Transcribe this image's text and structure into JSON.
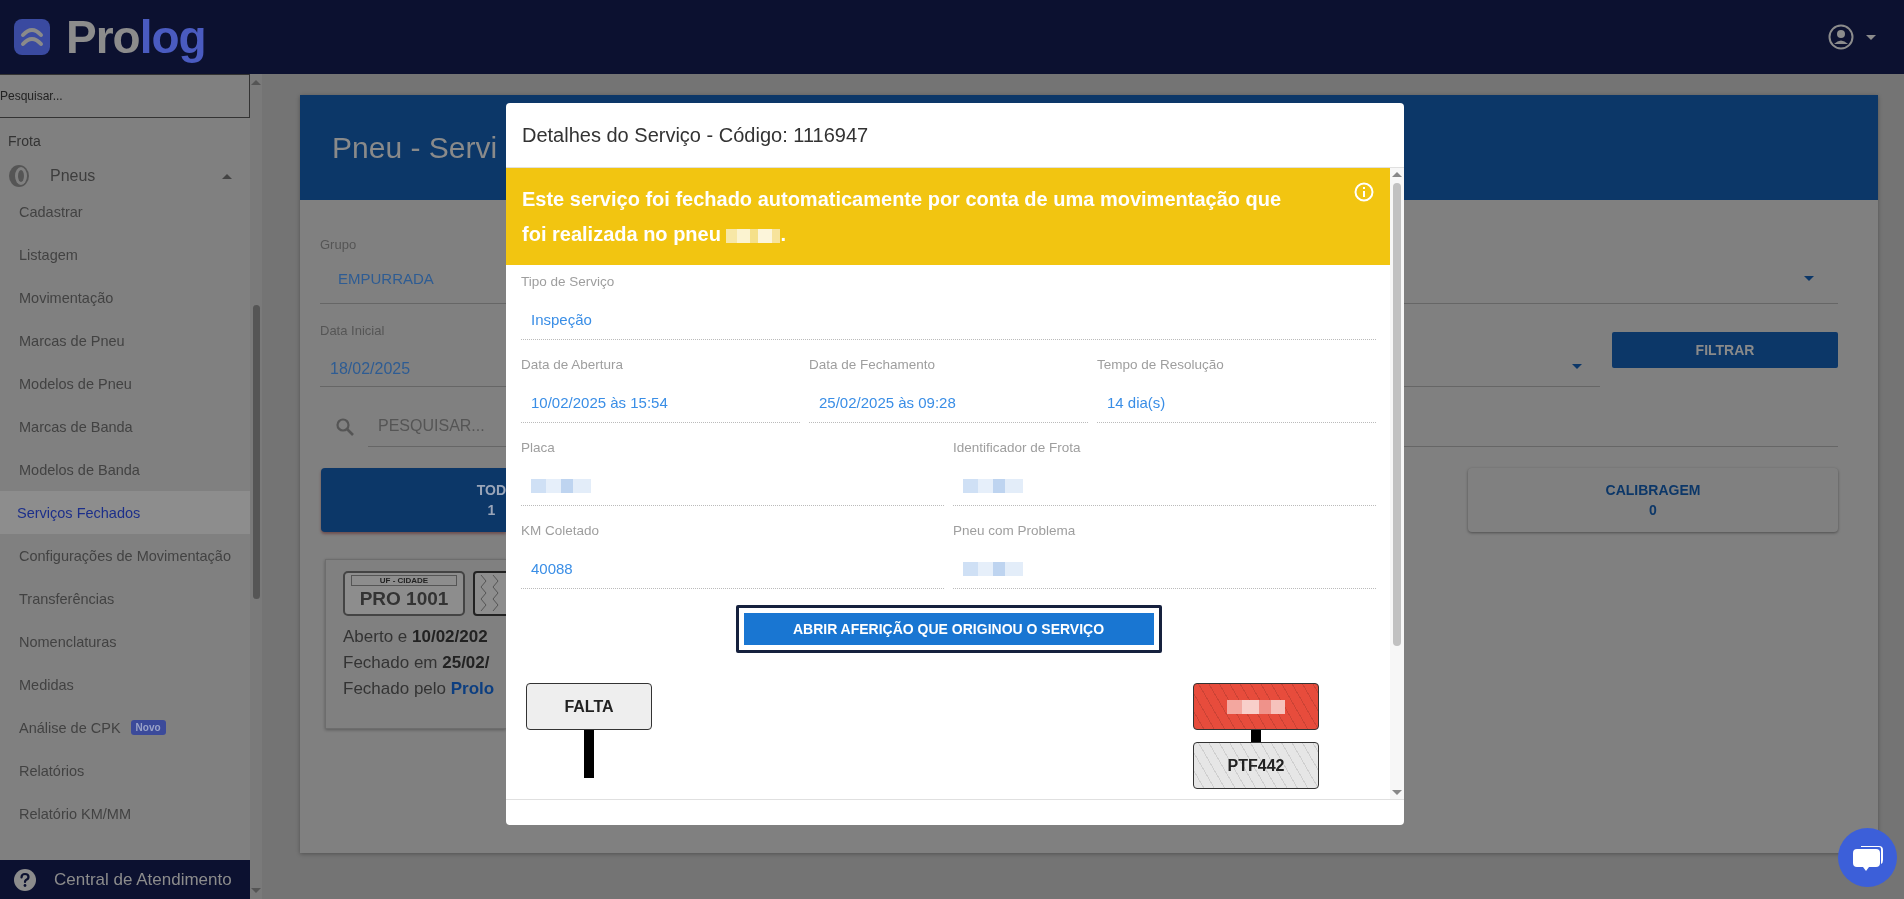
{
  "header": {
    "logo_text": "Prolog"
  },
  "sidebar": {
    "search": {
      "placeholder": "Pesquisar..."
    },
    "section": "Frota",
    "groups": [
      {
        "label": "Pneus",
        "expanded": true,
        "children": [
          {
            "label": "Cadastrar",
            "selected": false
          },
          {
            "label": "Listagem",
            "selected": false
          },
          {
            "label": "Movimentação",
            "selected": false
          },
          {
            "label": "Marcas de Pneu",
            "selected": false
          },
          {
            "label": "Modelos de Pneu",
            "selected": false
          },
          {
            "label": "Marcas de Banda",
            "selected": false
          },
          {
            "label": "Modelos de Banda",
            "selected": false
          },
          {
            "label": "Serviços Fechados",
            "selected": true
          },
          {
            "label": "Configurações de Movimentação",
            "selected": false
          },
          {
            "label": "Transferências",
            "selected": false
          },
          {
            "label": "Nomenclaturas",
            "selected": false
          },
          {
            "label": "Medidas",
            "selected": false
          },
          {
            "label": "Análise de CPK",
            "selected": false,
            "badge": "Novo"
          },
          {
            "label": "Relatórios",
            "selected": false
          },
          {
            "label": "Relatório KM/MM",
            "selected": false
          }
        ]
      }
    ],
    "help": "Central de Atendimento"
  },
  "page": {
    "title": "Pneu - Servi",
    "group_filter": {
      "label": "Grupo",
      "value": "EMPURRADA"
    },
    "start_date": {
      "label": "Data Inicial",
      "value": "18/02/2025"
    },
    "filter_button": "FILTRAR",
    "search": {
      "placeholder": "PESQUISAR..."
    },
    "tabs": [
      {
        "label": "TOD",
        "count": "1",
        "selected": true
      },
      {
        "label": "CALIBRAGEM",
        "count": "0",
        "selected": false
      }
    ],
    "service_card": {
      "plate_header": "UF - CIDADE",
      "plate": "PRO 1001",
      "opened": "Aberto e **10/02/202**",
      "closed": "Fechado em **25/02/**",
      "closed_by": "Fechado pelo",
      "closed_by_link": "Prolo"
    }
  },
  "modal": {
    "title": "Detalhes do Serviço - Código: 1116947",
    "banner": {
      "message": "Este serviço foi fechado automaticamente por conta de uma movimentação que foi realizada no pneu",
      "message_end": "."
    },
    "rows": [
      {
        "fields": [
          {
            "label": "Tipo de Serviço",
            "kind": "text",
            "value": "Inspeção"
          }
        ]
      },
      {
        "fields": [
          {
            "label": "Data de Abertura",
            "kind": "text",
            "value": "10/02/2025 às 15:54"
          },
          {
            "label": "Data de Fechamento",
            "kind": "text",
            "value": "25/02/2025 às 09:28"
          },
          {
            "label": "Tempo de Resolução",
            "kind": "text",
            "value": "14 dia(s)"
          }
        ]
      },
      {
        "fields": [
          {
            "label": "Placa",
            "kind": "redacted"
          },
          {
            "label": "Identificador de Frota",
            "kind": "redacted"
          }
        ]
      },
      {
        "fields": [
          {
            "label": "KM Coletado",
            "kind": "text",
            "value": "40088"
          },
          {
            "label": "Pneu com Problema",
            "kind": "redacted"
          }
        ]
      }
    ],
    "button": {
      "label": "ABRIR AFERIÇÃO QUE ORIGINOU O SERVIÇO",
      "focused": true
    },
    "diagram": {
      "left": [
        {
          "kind": "missing",
          "label": "FALTA"
        }
      ],
      "right": [
        {
          "kind": "problem"
        },
        {
          "kind": "ok",
          "label": "PTF442"
        }
      ]
    }
  }
}
